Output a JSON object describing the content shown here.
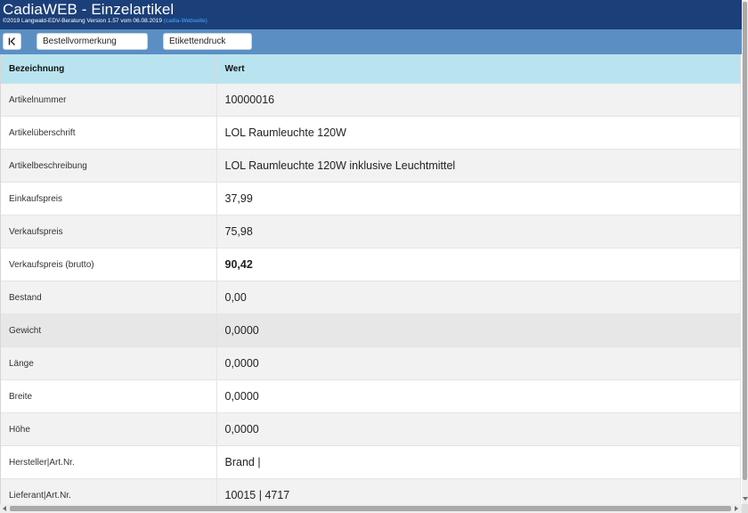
{
  "header": {
    "title": "CadiaWEB - Einzelartikel",
    "copyright": "©2019 Langwald-EDV-Beratung Version 1.57 vom 06.08.2019",
    "site_link": "(cadia-Webseite)",
    "background_color": "#1b3f78"
  },
  "toolbar": {
    "first_button_icon": "skip-to-first-icon",
    "bestellvormerkung_label": "Bestellvormerkung",
    "etikettendruck_label": "Etikettendruck",
    "background_color": "#5b8fc4"
  },
  "table": {
    "header_color": "#b9e4ef",
    "columns": [
      "Bezeichnung",
      "Wert"
    ],
    "rows": [
      {
        "label": "Artikelnummer",
        "value": "10000016"
      },
      {
        "label": "Artikelüberschrift",
        "value": "LOL Raumleuchte 120W"
      },
      {
        "label": "Artikelbeschreibung",
        "value": "LOL Raumleuchte 120W inklusive Leuchtmittel"
      },
      {
        "label": "Einkaufspreis",
        "value": "37,99"
      },
      {
        "label": "Verkaufspreis",
        "value": "75,98"
      },
      {
        "label": "Verkaufspreis (brutto)",
        "value": "90,42"
      },
      {
        "label": "Bestand",
        "value": "0,00"
      },
      {
        "label": "Gewicht",
        "value": "0,0000"
      },
      {
        "label": "Länge",
        "value": "0,0000"
      },
      {
        "label": "Breite",
        "value": "0,0000"
      },
      {
        "label": "Höhe",
        "value": "0,0000"
      },
      {
        "label": "Hersteller|Art.Nr.",
        "value": "Brand |"
      },
      {
        "label": "Lieferant|Art.Nr.",
        "value": "10015 | 4717"
      }
    ]
  }
}
